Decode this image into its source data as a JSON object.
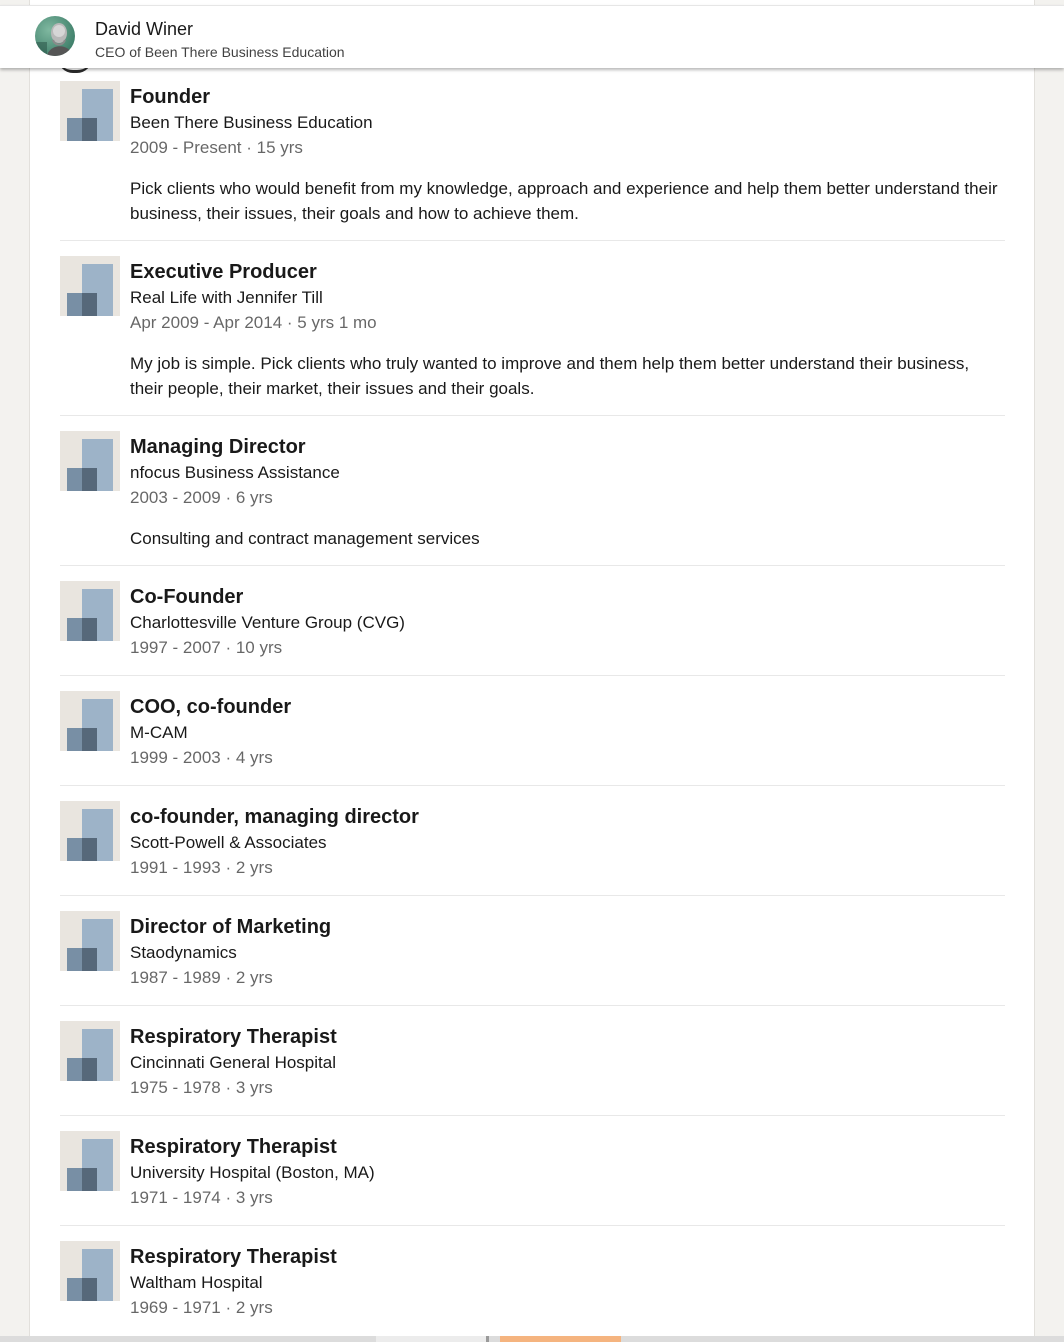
{
  "profile": {
    "name": "David Winer",
    "headline": "CEO of Been There Business Education"
  },
  "experience": [
    {
      "title": "Founder",
      "company": "Been There Business Education",
      "dates": "2009 - Present · 15 yrs",
      "description": "Pick clients who would benefit from my knowledge, approach and experience and help them better understand their business, their issues, their goals and how to achieve them."
    },
    {
      "title": "Executive Producer",
      "company": "Real Life with Jennifer Till",
      "dates": "Apr 2009 - Apr 2014 · 5 yrs 1 mo",
      "description": "My job is simple. Pick clients who truly wanted to improve and them help them better understand their business, their people, their market, their issues and their goals."
    },
    {
      "title": "Managing Director",
      "company": "nfocus Business Assistance",
      "dates": "2003 - 2009 · 6 yrs",
      "description": "Consulting and contract management services"
    },
    {
      "title": "Co-Founder",
      "company": "Charlottesville Venture Group (CVG)",
      "dates": "1997 - 2007 · 10 yrs"
    },
    {
      "title": "COO, co-founder",
      "company": "M-CAM",
      "dates": "1999 - 2003 · 4 yrs"
    },
    {
      "title": "co-founder, managing director",
      "company": "Scott-Powell & Associates",
      "dates": "1991 - 1993 · 2 yrs"
    },
    {
      "title": "Director of Marketing",
      "company": "Staodynamics",
      "dates": "1987 - 1989 · 2 yrs"
    },
    {
      "title": "Respiratory Therapist",
      "company": "Cincinnati General Hospital",
      "dates": "1975 - 1978 · 3 yrs"
    },
    {
      "title": "Respiratory Therapist",
      "company": "University Hospital (Boston, MA)",
      "dates": "1971 - 1974 · 3 yrs"
    },
    {
      "title": "Respiratory Therapist",
      "company": "Waltham Hospital",
      "dates": "1969 - 1971 · 2 yrs"
    }
  ],
  "icons": {
    "avatar": "profile-photo",
    "company_logo": "company-logo-placeholder-icon"
  },
  "colors": {
    "page_background": "#f3f2ef",
    "card_background": "#ffffff",
    "logo_background": "#e9e5df",
    "logo_bar_light": "#9db3c8",
    "logo_bar_dark": "#56687a",
    "secondary_text": "rgba(0,0,0,0.6)",
    "bottom_accent": "#f5b47f"
  }
}
